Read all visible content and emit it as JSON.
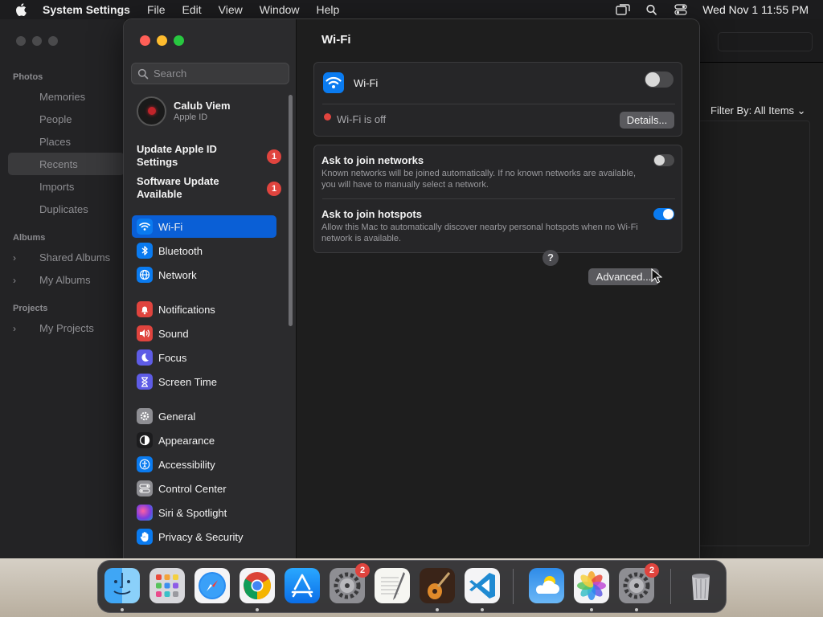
{
  "menubar": {
    "app_name": "System Settings",
    "items": [
      "File",
      "Edit",
      "View",
      "Window",
      "Help"
    ],
    "clock": "Wed Nov 1  11:55 PM",
    "icons": [
      "apple-logo",
      "screen-mirroring-icon",
      "spotlight-search-icon",
      "control-center-icon"
    ]
  },
  "photos": {
    "sections": {
      "photos": "Photos",
      "albums": "Albums",
      "projects": "Projects"
    },
    "items": [
      "Memories",
      "People",
      "Places",
      "Recents",
      "Imports",
      "Duplicates"
    ],
    "album_items": [
      "Shared Albums",
      "My Albums"
    ],
    "project_items": [
      "My Projects"
    ],
    "selected": "Recents",
    "filter": "Filter By: All Items"
  },
  "sidebar": {
    "search_placeholder": "Search",
    "profile": {
      "name": "Calub Viem",
      "subtitle": "Apple ID"
    },
    "notices": [
      {
        "label": "Update Apple ID Settings",
        "badge": "1"
      },
      {
        "label": "Software Update Available",
        "badge": "1"
      }
    ],
    "items": [
      {
        "label": "Wi-Fi",
        "icon": "wifi-icon",
        "color": "#0a7bf0",
        "selected": true
      },
      {
        "label": "Bluetooth",
        "icon": "bluetooth-icon",
        "color": "#0a7bf0"
      },
      {
        "label": "Network",
        "icon": "globe-icon",
        "color": "#0a7bf0"
      },
      {
        "label": "Notifications",
        "icon": "bell-icon",
        "color": "#e0443e"
      },
      {
        "label": "Sound",
        "icon": "speaker-icon",
        "color": "#e0443e"
      },
      {
        "label": "Focus",
        "icon": "moon-icon",
        "color": "#5e5ce6"
      },
      {
        "label": "Screen Time",
        "icon": "hourglass-icon",
        "color": "#5e5ce6"
      },
      {
        "label": "General",
        "icon": "gear-icon",
        "color": "#8e8e93"
      },
      {
        "label": "Appearance",
        "icon": "appearance-icon",
        "color": "#1c1c1e"
      },
      {
        "label": "Accessibility",
        "icon": "accessibility-icon",
        "color": "#0a7bf0"
      },
      {
        "label": "Control Center",
        "icon": "control-center-icon",
        "color": "#8e8e93"
      },
      {
        "label": "Siri & Spotlight",
        "icon": "siri-icon",
        "color": "#b04ad6"
      },
      {
        "label": "Privacy & Security",
        "icon": "hand-icon",
        "color": "#0a7bf0"
      }
    ]
  },
  "main": {
    "title": "Wi-Fi",
    "wifi_label": "Wi-Fi",
    "wifi_enabled": false,
    "status_text": "Wi-Fi is off",
    "details_button": "Details...",
    "join_networks": {
      "title": "Ask to join networks",
      "description": "Known networks will be joined automatically. If no known networks are available, you will have to manually select a network.",
      "enabled": false
    },
    "join_hotspots": {
      "title": "Ask to join hotspots",
      "description": "Allow this Mac to automatically discover nearby personal hotspots when no Wi-Fi network is available.",
      "enabled": true
    },
    "advanced_button": "Advanced...",
    "help_button": "?"
  },
  "dock": {
    "apps": [
      {
        "name": "Finder",
        "icon": "finder-icon"
      },
      {
        "name": "Launchpad",
        "icon": "launchpad-icon"
      },
      {
        "name": "Safari",
        "icon": "safari-icon"
      },
      {
        "name": "Chrome",
        "icon": "chrome-icon"
      },
      {
        "name": "App Store",
        "icon": "app-store-icon"
      },
      {
        "name": "System Preferences",
        "icon": "system-preferences-icon",
        "badge": "2"
      },
      {
        "name": "TextEdit",
        "icon": "textedit-icon"
      },
      {
        "name": "GarageBand",
        "icon": "garageband-icon"
      },
      {
        "name": "Visual Studio Code",
        "icon": "vscode-icon"
      },
      {
        "name": "Weather",
        "icon": "weather-icon"
      },
      {
        "name": "Photos",
        "icon": "photos-icon"
      },
      {
        "name": "System Settings",
        "icon": "system-settings-icon",
        "badge": "2"
      },
      {
        "name": "Trash",
        "icon": "trash-icon"
      }
    ]
  }
}
